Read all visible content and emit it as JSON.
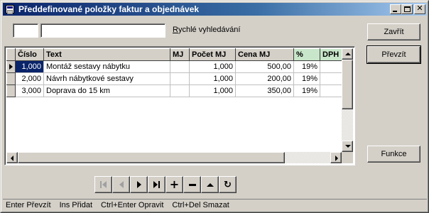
{
  "window": {
    "title": "Předdefinované položky faktur a objednávek"
  },
  "search": {
    "code_value": "",
    "text_value": "",
    "label": "Rychlé vyhledávání"
  },
  "buttons": {
    "close": "Zavřít",
    "take": "Převzít",
    "functions": "Funkce"
  },
  "table": {
    "columns": [
      "Číslo",
      "Text",
      "MJ",
      "Počet MJ",
      "Cena MJ",
      "%",
      "DPH"
    ],
    "rows": [
      {
        "cislo": "1,000",
        "text": "Montáž sestavy nábytku",
        "mj": "",
        "pocet": "1,000",
        "cena": "500,00",
        "pct": "19%",
        "dph": ""
      },
      {
        "cislo": "2,000",
        "text": "Návrh nábytkové sestavy",
        "mj": "",
        "pocet": "1,000",
        "cena": "200,00",
        "pct": "19%",
        "dph": ""
      },
      {
        "cislo": "3,000",
        "text": "Doprava do 15 km",
        "mj": "",
        "pocet": "1,000",
        "cena": "350,00",
        "pct": "19%",
        "dph": ""
      }
    ]
  },
  "navigator": {
    "icons": [
      "first-record-icon",
      "prior-record-icon",
      "next-record-icon",
      "last-record-icon",
      "insert-icon",
      "delete-icon",
      "edit-icon",
      "refresh-icon"
    ]
  },
  "statusbar": {
    "items": [
      "Enter Převzít",
      "Ins Přidat",
      "Ctrl+Enter Opravit",
      "Ctrl+Del Smazat"
    ]
  },
  "colors": {
    "title_start": "#0a246a",
    "title_end": "#a6caf0",
    "face": "#d4d0c8",
    "selected_header": "#c8e6c9",
    "active_cell": "#0a246a"
  }
}
